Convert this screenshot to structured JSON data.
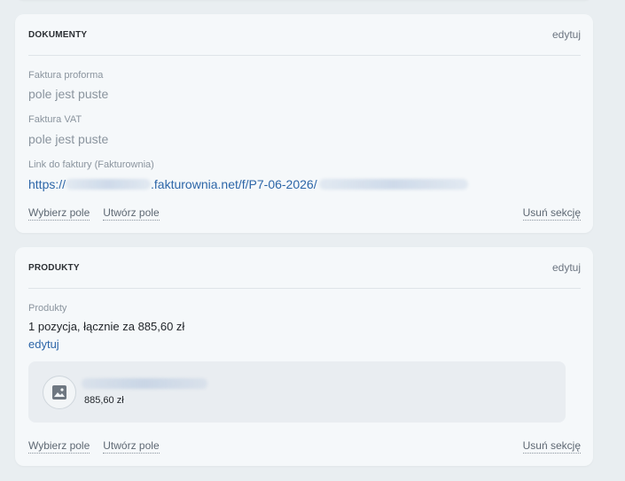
{
  "documents": {
    "title": "DOKUMENTY",
    "edit_label": "edytuj",
    "fields": [
      {
        "label": "Faktura proforma",
        "value": "pole jest puste"
      },
      {
        "label": "Faktura VAT",
        "value": "pole jest puste"
      }
    ],
    "invoice_link": {
      "label": "Link do faktury (Fakturownia)",
      "prefix": "https://",
      "middle": ".fakturownia.net/f/P7-06-2026/"
    },
    "footer": {
      "choose_field": "Wybierz pole",
      "create_field": "Utwórz pole",
      "remove_section": "Usuń sekcję"
    }
  },
  "products": {
    "title": "PRODUKTY",
    "edit_label": "edytuj",
    "field_label": "Produkty",
    "summary": "1 pozycja, łącznie za 885,60 zł",
    "summary_edit": "edytuj",
    "items": [
      {
        "price": "885,60 zł",
        "icon": "image-icon"
      }
    ],
    "footer": {
      "choose_field": "Wybierz pole",
      "create_field": "Utwórz pole",
      "remove_section": "Usuń sekcję"
    }
  },
  "colors": {
    "background": "#e9eef1",
    "card": "#f5f8fa",
    "link": "#2d66a8",
    "muted": "#8a949e"
  }
}
